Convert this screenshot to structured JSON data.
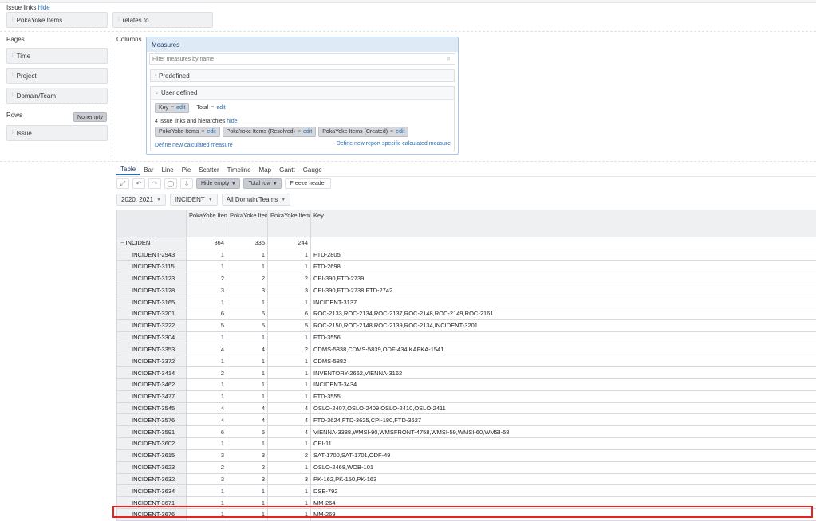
{
  "issue_links": {
    "label": "Issue links",
    "hide": "hide"
  },
  "top_slots": [
    "PokaYoke Items",
    "relates to"
  ],
  "pages": {
    "label": "Pages",
    "items": [
      "Time",
      "Project",
      "Domain/Team"
    ]
  },
  "rows": {
    "label": "Rows",
    "nonempty": "Nonempty",
    "items": [
      "Issue"
    ]
  },
  "columns": {
    "label": "Columns"
  },
  "measures": {
    "title": "Measures",
    "filter_placeholder": "Filter measures by name",
    "predefined": "Predefined",
    "user_defined": "User defined",
    "user_chips": [
      {
        "name": "Key",
        "edit": "edit"
      },
      {
        "name": "Total",
        "edit": "edit"
      }
    ],
    "links_text": "4 Issue links and hierarchies",
    "links_hide": "hide",
    "link_chips": [
      {
        "name": "PokaYoke Items",
        "edit": "edit"
      },
      {
        "name": "PokaYoke Items (Resolved)",
        "edit": "edit"
      },
      {
        "name": "PokaYoke Items (Created)",
        "edit": "edit"
      }
    ],
    "define_calc": "Define new calculated measure",
    "define_report": "Define new report specific calculated measure",
    "eq": "="
  },
  "view_tabs": [
    "Table",
    "Bar",
    "Line",
    "Pie",
    "Scatter",
    "Timeline",
    "Map",
    "Gantt",
    "Gauge"
  ],
  "toolbar": {
    "hide_empty": "Hide empty",
    "total_row": "Total row",
    "freeze_header": "Freeze header"
  },
  "filters": [
    "2020, 2021",
    "INCIDENT",
    "All Domain/Teams"
  ],
  "table": {
    "headers": [
      "PokaYoke Items",
      "PokaYoke Items (Created)",
      "PokaYoke Items (Resolved)",
      "Key"
    ],
    "total": {
      "label": "INCIDENT",
      "items": "364",
      "created": "335",
      "resolved": "244",
      "key": ""
    },
    "rows": [
      {
        "label": "INCIDENT-2943",
        "items": "1",
        "created": "1",
        "resolved": "1",
        "key": "FTD-2805"
      },
      {
        "label": "INCIDENT-3115",
        "items": "1",
        "created": "1",
        "resolved": "1",
        "key": "FTD-2698"
      },
      {
        "label": "INCIDENT-3123",
        "items": "2",
        "created": "2",
        "resolved": "2",
        "key": "CPI-390,FTD-2739"
      },
      {
        "label": "INCIDENT-3128",
        "items": "3",
        "created": "3",
        "resolved": "3",
        "key": "CPI-390,FTD-2738,FTD-2742"
      },
      {
        "label": "INCIDENT-3165",
        "items": "1",
        "created": "1",
        "resolved": "1",
        "key": "INCIDENT-3137"
      },
      {
        "label": "INCIDENT-3201",
        "items": "6",
        "created": "6",
        "resolved": "6",
        "key": "ROC-2133,ROC-2134,ROC-2137,ROC-2148,ROC-2149,ROC-2161"
      },
      {
        "label": "INCIDENT-3222",
        "items": "5",
        "created": "5",
        "resolved": "5",
        "key": "ROC-2150,ROC-2148,ROC-2139,ROC-2134,INCIDENT-3201"
      },
      {
        "label": "INCIDENT-3304",
        "items": "1",
        "created": "1",
        "resolved": "1",
        "key": "FTD-3556"
      },
      {
        "label": "INCIDENT-3353",
        "items": "4",
        "created": "4",
        "resolved": "2",
        "key": "CDMS-5838,CDMS-5839,ODF-434,KAFKA-1541"
      },
      {
        "label": "INCIDENT-3372",
        "items": "1",
        "created": "1",
        "resolved": "1",
        "key": "CDMS-5882"
      },
      {
        "label": "INCIDENT-3414",
        "items": "2",
        "created": "1",
        "resolved": "1",
        "key": "INVENTORY-2662,VIENNA-3162"
      },
      {
        "label": "INCIDENT-3462",
        "items": "1",
        "created": "1",
        "resolved": "1",
        "key": "INCIDENT-3434"
      },
      {
        "label": "INCIDENT-3477",
        "items": "1",
        "created": "1",
        "resolved": "1",
        "key": "FTD-3555"
      },
      {
        "label": "INCIDENT-3545",
        "items": "4",
        "created": "4",
        "resolved": "4",
        "key": "OSLO-2407,OSLO-2409,OSLO-2410,OSLO-2411"
      },
      {
        "label": "INCIDENT-3576",
        "items": "4",
        "created": "4",
        "resolved": "4",
        "key": "FTD-3624,FTD-3625,CPI-180,FTD-3627"
      },
      {
        "label": "INCIDENT-3591",
        "items": "6",
        "created": "5",
        "resolved": "4",
        "key": "VIENNA-3388,WMSI-90,WMSFRONT-4758,WMSI-59,WMSI-60,WMSI-58"
      },
      {
        "label": "INCIDENT-3602",
        "items": "1",
        "created": "1",
        "resolved": "1",
        "key": "CPI-11"
      },
      {
        "label": "INCIDENT-3615",
        "items": "3",
        "created": "3",
        "resolved": "2",
        "key": "SAT-1700,SAT-1701,ODF-49"
      },
      {
        "label": "INCIDENT-3623",
        "items": "2",
        "created": "2",
        "resolved": "1",
        "key": "OSLO-2468,WOB-101"
      },
      {
        "label": "INCIDENT-3632",
        "items": "3",
        "created": "3",
        "resolved": "3",
        "key": "PK-162,PK-150,PK-163"
      },
      {
        "label": "INCIDENT-3634",
        "items": "1",
        "created": "1",
        "resolved": "1",
        "key": "DSE-792"
      },
      {
        "label": "INCIDENT-3671",
        "items": "1",
        "created": "1",
        "resolved": "1",
        "key": "MM-264"
      },
      {
        "label": "INCIDENT-3676",
        "items": "1",
        "created": "1",
        "resolved": "1",
        "key": "MM-269"
      }
    ]
  },
  "colors": {
    "accent": "#2b6cb0",
    "highlight": "#e8231f",
    "measures_header": "#dfeaf7"
  }
}
